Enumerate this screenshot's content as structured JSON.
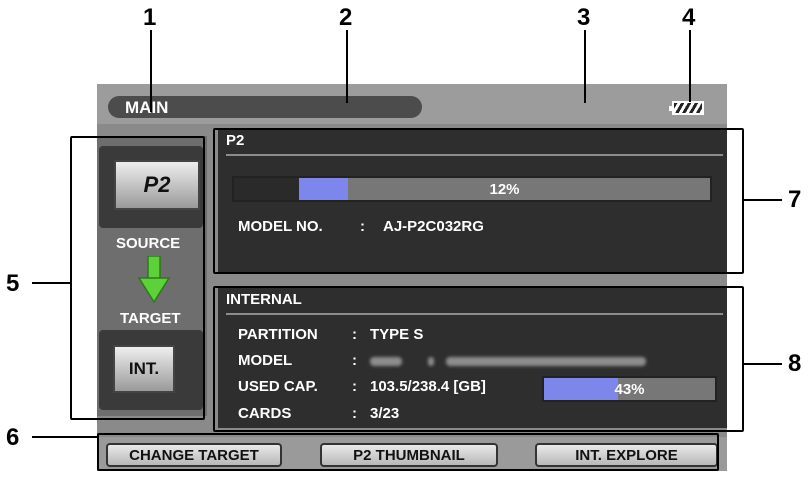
{
  "callouts": [
    "1",
    "2",
    "3",
    "4",
    "5",
    "6",
    "7",
    "8"
  ],
  "header": {
    "title": "MAIN"
  },
  "left_panel": {
    "source_label": "SOURCE",
    "target_label": "TARGET",
    "source_chip": "P2",
    "target_chip": "INT."
  },
  "p2": {
    "title": "P2",
    "usage_percent": 12,
    "usage_label": "12%",
    "model_label": "MODEL NO.",
    "model_sep": ":",
    "model_value": "AJ-P2C032RG"
  },
  "internal": {
    "title": "INTERNAL",
    "rows": [
      {
        "label": "PARTITION",
        "sep": ":",
        "value": "TYPE S"
      },
      {
        "label": "MODEL",
        "sep": ":",
        "value": ""
      },
      {
        "label": "USED CAP.",
        "sep": ":",
        "value": "103.5/238.4 [GB]"
      },
      {
        "label": "CARDS",
        "sep": ":",
        "value": "3/23"
      }
    ],
    "usage_percent": 43,
    "usage_label": "43%"
  },
  "footer": {
    "buttons": [
      "CHANGE TARGET",
      "P2 THUMBNAIL",
      "INT. EXPLORE"
    ]
  },
  "colors": {
    "bar_fill": "#7d86ea",
    "screen_bg": "#8a8a8a",
    "panel_bg": "#2e2e2e"
  }
}
